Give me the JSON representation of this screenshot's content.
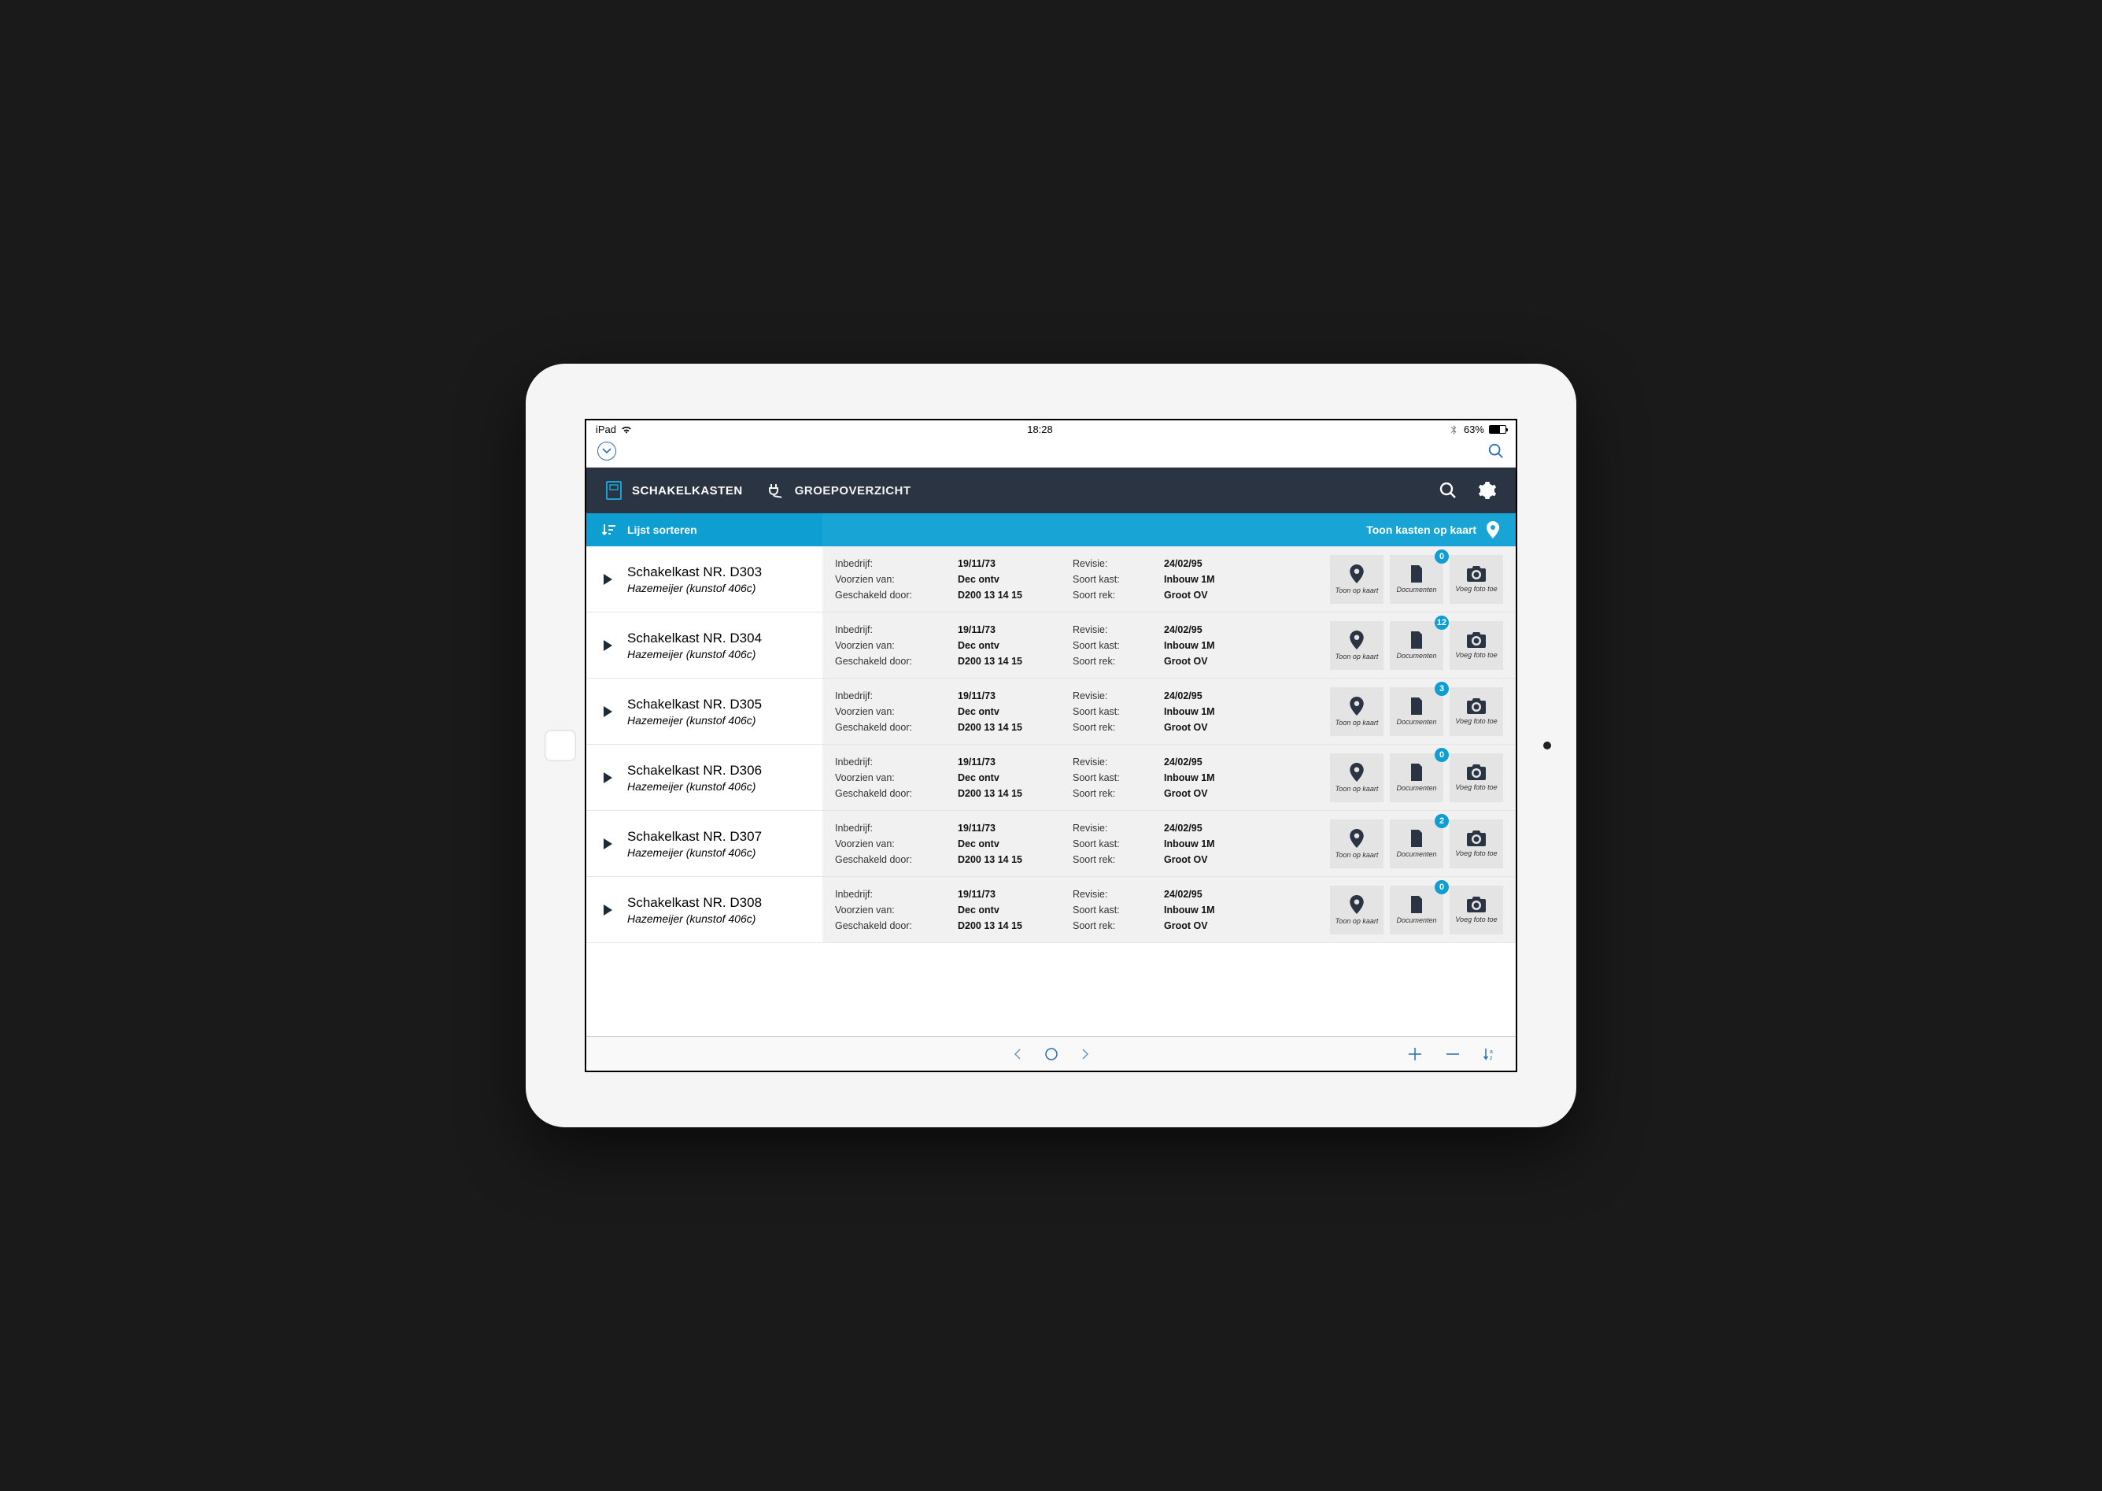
{
  "status": {
    "device": "iPad",
    "time": "18:28",
    "battery_pct": "63%"
  },
  "nav": {
    "tab1": "SCHAKELKASTEN",
    "tab2": "GROEPOVERZICHT"
  },
  "bluebar": {
    "sort_label": "Lijst sorteren",
    "map_label": "Toon kasten op kaart"
  },
  "field_labels": {
    "inbedrijf": "Inbedrijf:",
    "voorzien": "Voorzien van:",
    "geschakeld": "Geschakeld door:",
    "revisie": "Revisie:",
    "soort_kast": "Soort kast:",
    "soort_rek": "Soort rek:"
  },
  "action_labels": {
    "map": "Toon op kaart",
    "docs": "Documenten",
    "photo": "Voeg foto toe"
  },
  "rows": [
    {
      "title": "Schakelkast NR. D303",
      "sub": "Hazemeijer (kunstof 406c)",
      "inbedrijf": "19/11/73",
      "voorzien": "Dec ontv",
      "geschakeld": "D200 13 14 15",
      "revisie": "24/02/95",
      "soort_kast": "Inbouw 1M",
      "soort_rek": "Groot OV",
      "docs": "0"
    },
    {
      "title": "Schakelkast NR. D304",
      "sub": "Hazemeijer (kunstof 406c)",
      "inbedrijf": "19/11/73",
      "voorzien": "Dec ontv",
      "geschakeld": "D200 13 14 15",
      "revisie": "24/02/95",
      "soort_kast": "Inbouw 1M",
      "soort_rek": "Groot OV",
      "docs": "12"
    },
    {
      "title": "Schakelkast NR. D305",
      "sub": "Hazemeijer (kunstof 406c)",
      "inbedrijf": "19/11/73",
      "voorzien": "Dec ontv",
      "geschakeld": "D200 13 14 15",
      "revisie": "24/02/95",
      "soort_kast": "Inbouw 1M",
      "soort_rek": "Groot OV",
      "docs": "3"
    },
    {
      "title": "Schakelkast NR. D306",
      "sub": "Hazemeijer (kunstof 406c)",
      "inbedrijf": "19/11/73",
      "voorzien": "Dec ontv",
      "geschakeld": "D200 13 14 15",
      "revisie": "24/02/95",
      "soort_kast": "Inbouw 1M",
      "soort_rek": "Groot OV",
      "docs": "0"
    },
    {
      "title": "Schakelkast NR. D307",
      "sub": "Hazemeijer (kunstof 406c)",
      "inbedrijf": "19/11/73",
      "voorzien": "Dec ontv",
      "geschakeld": "D200 13 14 15",
      "revisie": "24/02/95",
      "soort_kast": "Inbouw 1M",
      "soort_rek": "Groot OV",
      "docs": "2"
    },
    {
      "title": "Schakelkast NR. D308",
      "sub": "Hazemeijer (kunstof 406c)",
      "inbedrijf": "19/11/73",
      "voorzien": "Dec ontv",
      "geschakeld": "D200 13 14 15",
      "revisie": "24/02/95",
      "soort_kast": "Inbouw 1M",
      "soort_rek": "Groot OV",
      "docs": "0"
    }
  ]
}
